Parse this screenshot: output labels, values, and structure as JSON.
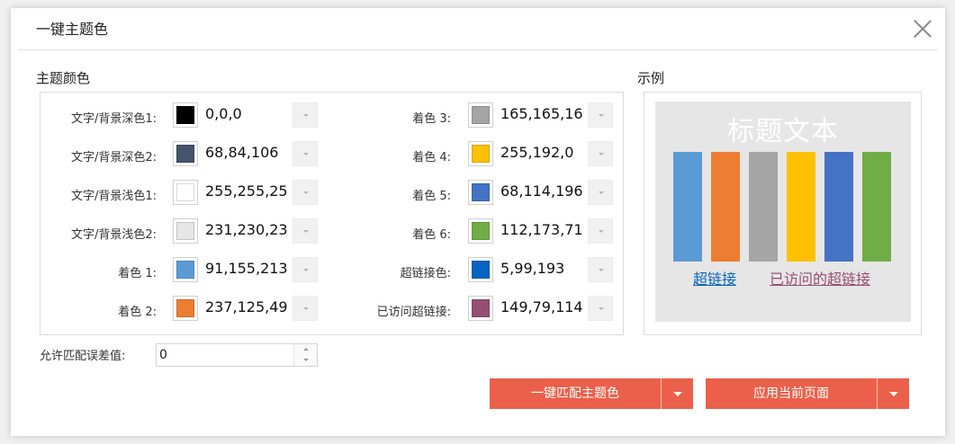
{
  "dialog": {
    "title": "一键主题色"
  },
  "theme_section": {
    "title": "主题颜色",
    "left": [
      {
        "label": "文字/背景深色1:",
        "value": "0,0,0",
        "color": "#000000"
      },
      {
        "label": "文字/背景深色2:",
        "value": "68,84,106",
        "color": "#44546A"
      },
      {
        "label": "文字/背景浅色1:",
        "value": "255,255,25",
        "color": "#FFFFFF"
      },
      {
        "label": "文字/背景浅色2:",
        "value": "231,230,23",
        "color": "#E7E6E6"
      },
      {
        "label": "着色 1:",
        "value": "91,155,213",
        "color": "#5B9BD5"
      },
      {
        "label": "着色 2:",
        "value": "237,125,49",
        "color": "#ED7D31"
      }
    ],
    "right": [
      {
        "label": "着色 3:",
        "value": "165,165,16",
        "color": "#A5A5A5"
      },
      {
        "label": "着色 4:",
        "value": "255,192,0",
        "color": "#FFC000"
      },
      {
        "label": "着色 5:",
        "value": "68,114,196",
        "color": "#4472C4"
      },
      {
        "label": "着色 6:",
        "value": "112,173,71",
        "color": "#70AD47"
      },
      {
        "label": "超链接色:",
        "value": "5,99,193",
        "color": "#0563C1"
      },
      {
        "label": "已访问超链接:",
        "value": "149,79,114",
        "color": "#954F72"
      }
    ]
  },
  "tolerance": {
    "label": "允许匹配误差值:",
    "value": "0"
  },
  "preview": {
    "title": "示例",
    "heading": "标题文本",
    "bars": [
      "#5B9BD5",
      "#ED7D31",
      "#A5A5A5",
      "#FFC000",
      "#4472C4",
      "#70AD47"
    ],
    "hyperlink": "超链接",
    "hyperlink_color": "#0563C1",
    "visited": "已访问的超链接",
    "visited_color": "#954F72"
  },
  "actions": {
    "match_label": "一键匹配主题色",
    "apply_label": "应用当前页面",
    "button_color": "#EB604A"
  }
}
